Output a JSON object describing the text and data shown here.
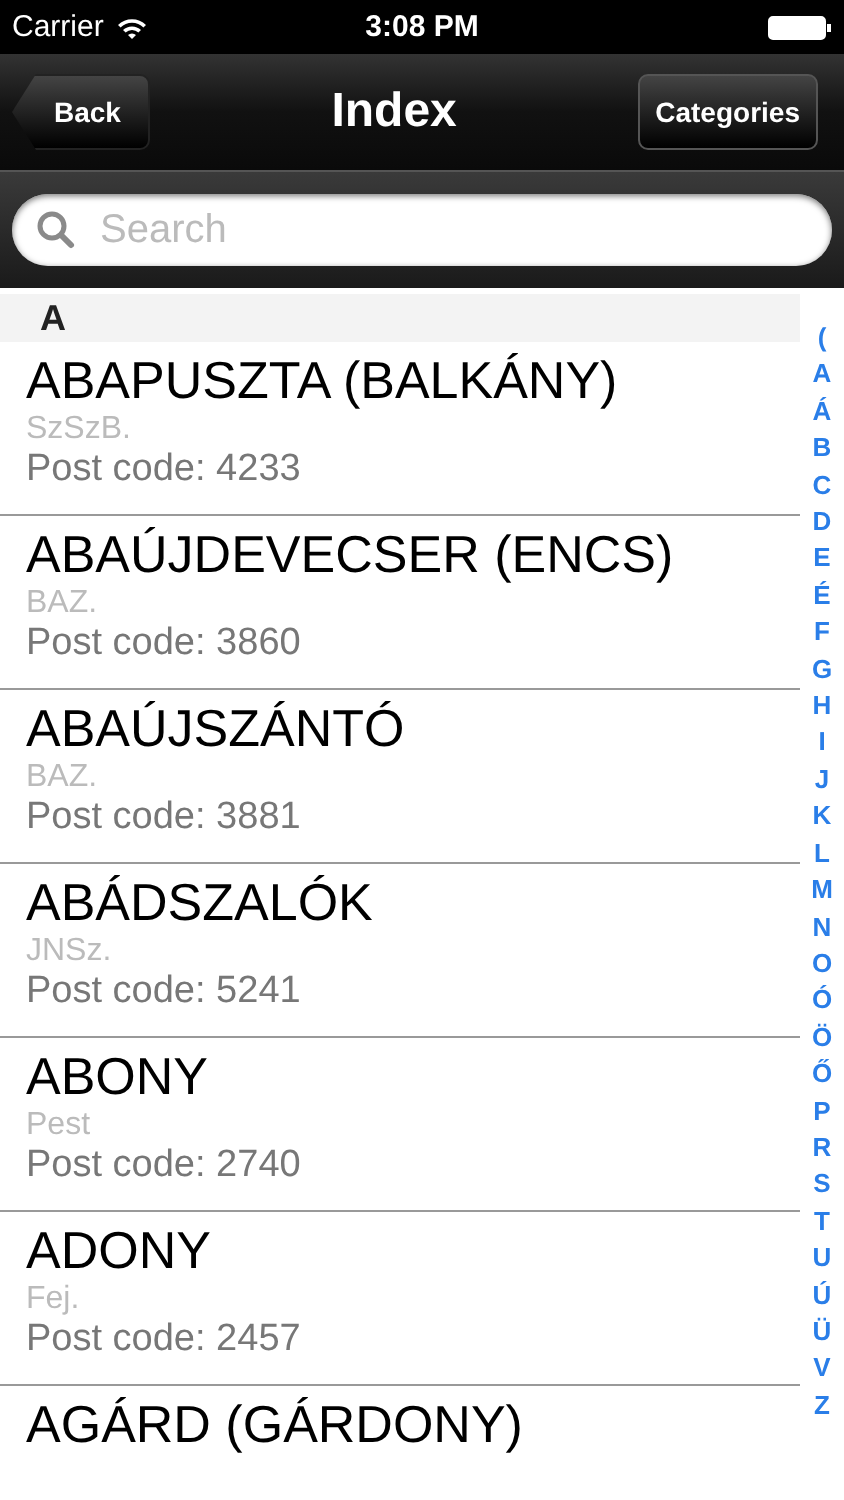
{
  "status_bar": {
    "carrier": "Carrier",
    "time": "3:08 PM"
  },
  "nav_bar": {
    "back": "Back",
    "title": "Index",
    "right_button": "Categories"
  },
  "search": {
    "placeholder": "Search"
  },
  "section": "A",
  "rows": [
    {
      "name": "ABAPUSZTA (BALKÁNY)",
      "region": "SzSzB.",
      "post_code": "Post code: 4233"
    },
    {
      "name": "ABAÚJDEVECSER (ENCS)",
      "region": "BAZ.",
      "post_code": "Post code: 3860"
    },
    {
      "name": "ABAÚJSZÁNTÓ",
      "region": "BAZ.",
      "post_code": "Post code: 3881"
    },
    {
      "name": "ABÁDSZALÓK",
      "region": "JNSz.",
      "post_code": "Post code: 5241"
    },
    {
      "name": "ABONY",
      "region": "Pest",
      "post_code": "Post code: 2740"
    },
    {
      "name": "ADONY",
      "region": "Fej.",
      "post_code": "Post code: 2457"
    },
    {
      "name": "AGÁRD (GÁRDONY)"
    }
  ],
  "index": [
    "(",
    "A",
    "Á",
    "B",
    "C",
    "D",
    "E",
    "É",
    "F",
    "G",
    "H",
    "I",
    "J",
    "K",
    "L",
    "M",
    "N",
    "O",
    "Ó",
    "Ö",
    "Ő",
    "P",
    "R",
    "S",
    "T",
    "U",
    "Ú",
    "Ü",
    "V",
    "Z"
  ]
}
